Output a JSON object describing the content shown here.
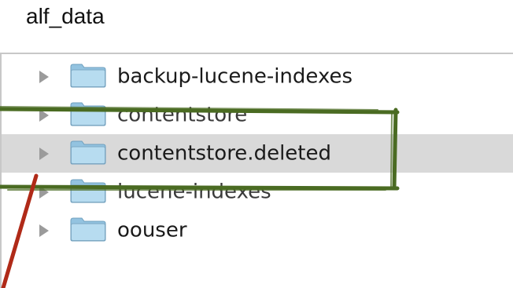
{
  "header": {
    "title": "alf_data"
  },
  "folders": [
    {
      "label": "backup-lucene-indexes",
      "icon": "folder-icon",
      "selected": false
    },
    {
      "label": "contentstore",
      "icon": "folder-icon",
      "selected": false
    },
    {
      "label": "contentstore.deleted",
      "icon": "folder-icon",
      "selected": true
    },
    {
      "label": "lucene-indexes",
      "icon": "folder-icon",
      "selected": false
    },
    {
      "label": "oouser",
      "icon": "folder-icon",
      "selected": false
    }
  ],
  "colors": {
    "highlight_box": "#4a6b22",
    "arrow": "#b02a18",
    "selected_row": "#d9d9d9",
    "folder_fill": "#a8d2ea"
  }
}
